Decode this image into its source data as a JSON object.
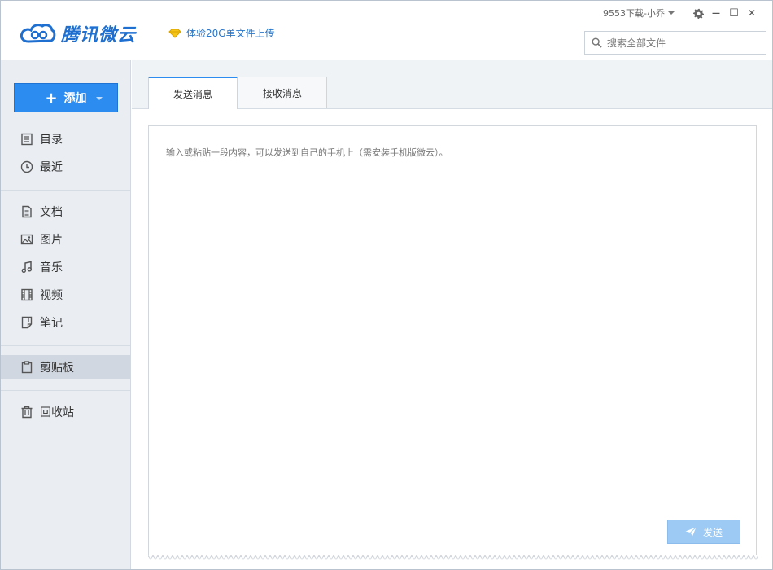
{
  "app": {
    "logo_text": "腾讯微云",
    "promo_text": "体验20G单文件上传",
    "user_name": "9553下载-小乔",
    "search_placeholder": "搜索全部文件"
  },
  "window_controls": {
    "settings_icon": "gear-icon",
    "minimize_glyph": "—",
    "maximize_glyph": "☐",
    "close_glyph": "✕"
  },
  "sidebar": {
    "add_label": "添加",
    "items": [
      {
        "label": "目录",
        "icon": "list-icon"
      },
      {
        "label": "最近",
        "icon": "clock-icon"
      },
      {
        "label": "文档",
        "icon": "document-icon"
      },
      {
        "label": "图片",
        "icon": "image-icon"
      },
      {
        "label": "音乐",
        "icon": "music-icon"
      },
      {
        "label": "视频",
        "icon": "film-icon"
      },
      {
        "label": "笔记",
        "icon": "note-icon"
      },
      {
        "label": "剪贴板",
        "icon": "clipboard-icon",
        "active": true
      },
      {
        "label": "回收站",
        "icon": "trash-icon"
      }
    ]
  },
  "main": {
    "tabs": [
      {
        "label": "发送消息",
        "active": true
      },
      {
        "label": "接收消息",
        "active": false
      }
    ],
    "editor_hint": "输入或粘贴一段内容，可以发送到自己的手机上（需安装手机版微云）。",
    "send_label": "发送"
  },
  "colors": {
    "accent": "#2d8cf0",
    "sidebar_bg": "#eaeef3",
    "active_item_bg": "#d1d7e0",
    "send_disabled": "#9ccaf5"
  }
}
